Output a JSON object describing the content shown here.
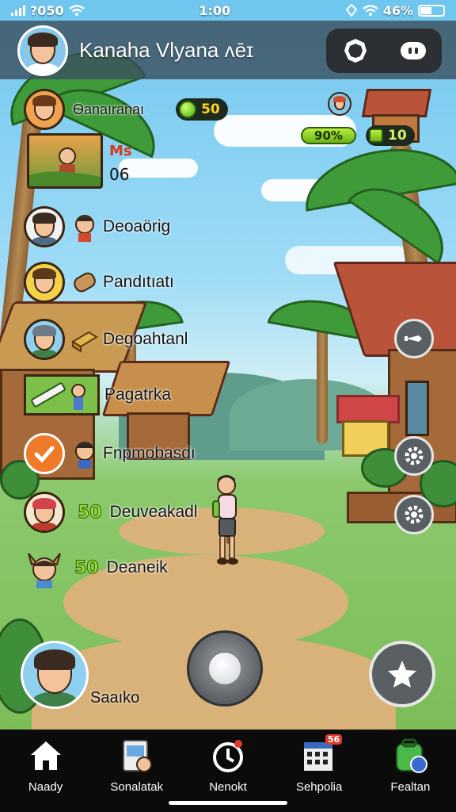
{
  "status_bar": {
    "carrier": "?050",
    "time": "1:00",
    "battery": "46%"
  },
  "header": {
    "title": "Kanaha Vlyana ᴧēɪ",
    "settings_icon": "gear-shield-icon",
    "chat_icon": "chat-bubble-icon"
  },
  "top_left": {
    "name": "Ѳanaıranaı",
    "gem_value": "50"
  },
  "quest_card": {
    "title": "Ms",
    "count": "06"
  },
  "top_right": {
    "progress_label": "90%",
    "house_value": "10"
  },
  "list": [
    {
      "label": "Deoaörig"
    },
    {
      "label": "Pandıtıatı"
    },
    {
      "label": "Degoahtanl"
    },
    {
      "label": "Pagatrka"
    },
    {
      "label": "Fnpmobasdı"
    },
    {
      "number": "50",
      "label": "Deuveakadl"
    },
    {
      "number": "50",
      "label": "Deaneik"
    }
  ],
  "right_buttons": [
    "sword-icon",
    "gear-icon",
    "gear-icon"
  ],
  "player": {
    "name": "Saaıko"
  },
  "tabs": [
    {
      "label": "Naady",
      "icon": "home-icon"
    },
    {
      "label": "Sonalatak",
      "icon": "card-icon"
    },
    {
      "label": "Nenokt",
      "icon": "timer-icon"
    },
    {
      "label": "Sehpolia",
      "icon": "calendar-icon",
      "badge": "56"
    },
    {
      "label": "Fealtan",
      "icon": "backpack-icon"
    }
  ]
}
